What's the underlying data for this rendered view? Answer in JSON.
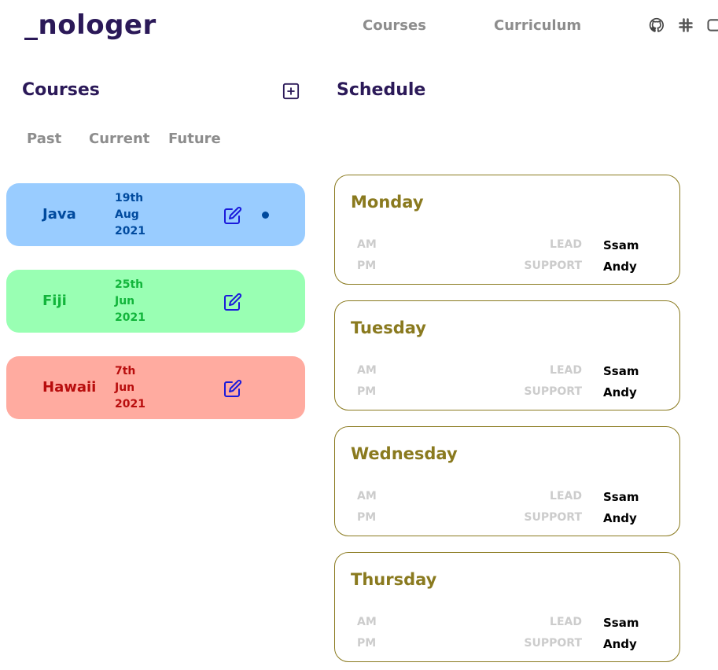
{
  "header": {
    "logo": "_nologer",
    "nav": [
      "Courses",
      "Curriculum"
    ],
    "icons": [
      "github-icon",
      "slack-icon",
      "discord-icon"
    ]
  },
  "courses": {
    "title": "Courses",
    "add_icon": "plus-square-icon",
    "tabs": [
      "Past",
      "Current",
      "Future"
    ],
    "items": [
      {
        "name": "Java",
        "date": [
          "19th",
          "Aug",
          "2021"
        ],
        "bg": "#99ccff",
        "fg": "#004a9e",
        "active": true
      },
      {
        "name": "Fiji",
        "date": [
          "25th",
          "Jun",
          "2021"
        ],
        "bg": "#99ffb3",
        "fg": "#12b53b",
        "active": false
      },
      {
        "name": "Hawaii",
        "date": [
          "7th",
          "Jun",
          "2021"
        ],
        "bg": "#ffaba0",
        "fg": "#b80d0d",
        "active": false
      }
    ]
  },
  "schedule": {
    "title": "Schedule",
    "slot_labels": [
      "AM",
      "PM"
    ],
    "role_labels": [
      "LEAD",
      "SUPPORT"
    ],
    "days": [
      {
        "day": "Monday",
        "lead": "Ssam",
        "support": "Andy"
      },
      {
        "day": "Tuesday",
        "lead": "Ssam",
        "support": "Andy"
      },
      {
        "day": "Wednesday",
        "lead": "Ssam",
        "support": "Andy"
      },
      {
        "day": "Thursday",
        "lead": "Ssam",
        "support": "Andy"
      }
    ]
  },
  "colors": {
    "brand": "#2b1958",
    "nav_gray": "#8d8d8d",
    "day_accent": "#8a7a1f",
    "edit_blue": "#1a1adb",
    "muted": "#cccccc"
  }
}
